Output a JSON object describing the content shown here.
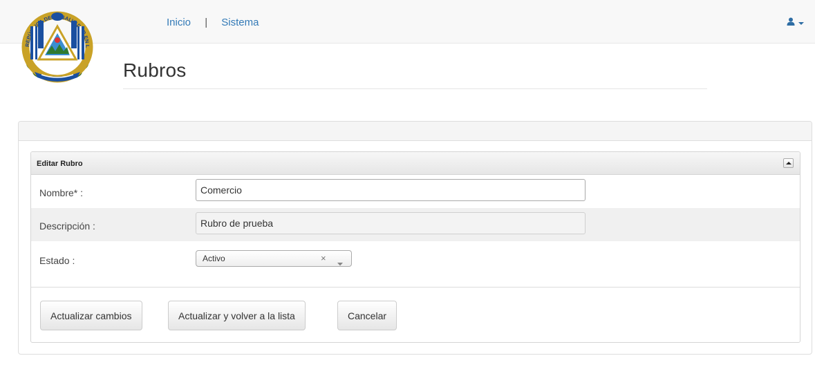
{
  "nav": {
    "home": "Inicio",
    "separator": "|",
    "system": "Sistema"
  },
  "user_menu": {
    "icon": "user-icon",
    "caret": "caret-down-icon"
  },
  "logo": {
    "name": "el-salvador-coat-of-arms",
    "arc_text": "REPÚBLICA DE EL SALVADOR EN LA AMÉRICA CENTRAL"
  },
  "page": {
    "title": "Rubros"
  },
  "form": {
    "section_title": "Editar Rubro",
    "collapse_icon": "triangle-up-icon",
    "fields": {
      "nombre": {
        "label": "Nombre* :",
        "value": "Comercio"
      },
      "descripcion": {
        "label": "Descripción :",
        "value": "Rubro de prueba"
      },
      "estado": {
        "label": "Estado :",
        "value": "Activo",
        "clear": "×"
      }
    },
    "buttons": {
      "update": "Actualizar cambios",
      "update_return": "Actualizar y volver a la lista",
      "cancel": "Cancelar"
    }
  },
  "colors": {
    "link": "#337ab7",
    "navbar_bg": "#f8f8f8",
    "accent": "#2e6da4"
  }
}
